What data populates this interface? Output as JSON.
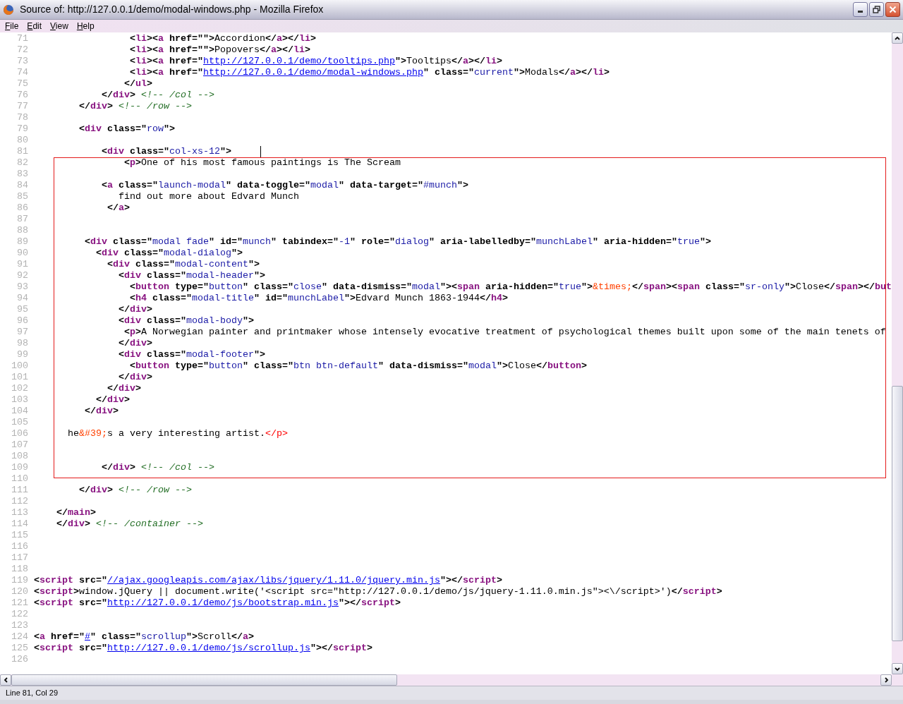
{
  "window": {
    "title": "Source of: http://127.0.0.1/demo/modal-windows.php - Mozilla Firefox"
  },
  "menu": [
    "File",
    "Edit",
    "View",
    "Help"
  ],
  "code_blocks": [
    {
      "highlighted": false,
      "lines": [
        {
          "number": "71",
          "cursor": false,
          "tokens": [
            {
              "kind": "markup",
              "text": "                 <"
            },
            {
              "kind": "tag",
              "text": "li"
            },
            {
              "kind": "markup",
              "text": "><"
            },
            {
              "kind": "tag",
              "text": "a"
            },
            {
              "kind": "markup",
              "text": " href=\"\">"
            },
            {
              "kind": "text",
              "text": "Accordion"
            },
            {
              "kind": "markup",
              "text": "</"
            },
            {
              "kind": "tag",
              "text": "a"
            },
            {
              "kind": "markup",
              "text": "></"
            },
            {
              "kind": "tag",
              "text": "li"
            },
            {
              "kind": "markup",
              "text": ">"
            }
          ]
        },
        {
          "number": "72",
          "cursor": false,
          "tokens": [
            {
              "kind": "markup",
              "text": "                 <"
            },
            {
              "kind": "tag",
              "text": "li"
            },
            {
              "kind": "markup",
              "text": "><"
            },
            {
              "kind": "tag",
              "text": "a"
            },
            {
              "kind": "markup",
              "text": " href=\"\">"
            },
            {
              "kind": "text",
              "text": "Popovers"
            },
            {
              "kind": "markup",
              "text": "</"
            },
            {
              "kind": "tag",
              "text": "a"
            },
            {
              "kind": "markup",
              "text": "></"
            },
            {
              "kind": "tag",
              "text": "li"
            },
            {
              "kind": "markup",
              "text": ">"
            }
          ]
        },
        {
          "number": "73",
          "cursor": false,
          "tokens": [
            {
              "kind": "markup",
              "text": "                 <"
            },
            {
              "kind": "tag",
              "text": "li"
            },
            {
              "kind": "markup",
              "text": "><"
            },
            {
              "kind": "tag",
              "text": "a"
            },
            {
              "kind": "markup",
              "text": " href=\""
            },
            {
              "kind": "link",
              "text": "http://127.0.0.1/demo/tooltips.php"
            },
            {
              "kind": "markup",
              "text": "\">"
            },
            {
              "kind": "text",
              "text": "Tooltips"
            },
            {
              "kind": "markup",
              "text": "</"
            },
            {
              "kind": "tag",
              "text": "a"
            },
            {
              "kind": "markup",
              "text": "></"
            },
            {
              "kind": "tag",
              "text": "li"
            },
            {
              "kind": "markup",
              "text": ">"
            }
          ]
        },
        {
          "number": "74",
          "cursor": false,
          "tokens": [
            {
              "kind": "markup",
              "text": "                 <"
            },
            {
              "kind": "tag",
              "text": "li"
            },
            {
              "kind": "markup",
              "text": "><"
            },
            {
              "kind": "tag",
              "text": "a"
            },
            {
              "kind": "markup",
              "text": " href=\""
            },
            {
              "kind": "link",
              "text": "http://127.0.0.1/demo/modal-windows.php"
            },
            {
              "kind": "markup",
              "text": "\" class=\""
            },
            {
              "kind": "value",
              "text": "current"
            },
            {
              "kind": "markup",
              "text": "\">"
            },
            {
              "kind": "text",
              "text": "Modals"
            },
            {
              "kind": "markup",
              "text": "</"
            },
            {
              "kind": "tag",
              "text": "a"
            },
            {
              "kind": "markup",
              "text": "></"
            },
            {
              "kind": "tag",
              "text": "li"
            },
            {
              "kind": "markup",
              "text": ">"
            }
          ]
        },
        {
          "number": "75",
          "cursor": false,
          "tokens": [
            {
              "kind": "markup",
              "text": "                </"
            },
            {
              "kind": "tag",
              "text": "ul"
            },
            {
              "kind": "markup",
              "text": ">"
            }
          ]
        },
        {
          "number": "76",
          "cursor": false,
          "tokens": [
            {
              "kind": "markup",
              "text": "            </"
            },
            {
              "kind": "tag",
              "text": "div"
            },
            {
              "kind": "markup",
              "text": "> "
            },
            {
              "kind": "comment",
              "text": "<!-- /col -->"
            }
          ]
        },
        {
          "number": "77",
          "cursor": false,
          "tokens": [
            {
              "kind": "markup",
              "text": "        </"
            },
            {
              "kind": "tag",
              "text": "div"
            },
            {
              "kind": "markup",
              "text": "> "
            },
            {
              "kind": "comment",
              "text": "<!-- /row -->"
            }
          ]
        },
        {
          "number": "78",
          "cursor": false
        },
        {
          "number": "79",
          "cursor": false,
          "tokens": [
            {
              "kind": "markup",
              "text": "        <"
            },
            {
              "kind": "tag",
              "text": "div"
            },
            {
              "kind": "markup",
              "text": " class=\""
            },
            {
              "kind": "value",
              "text": "row"
            },
            {
              "kind": "markup",
              "text": "\">"
            }
          ]
        },
        {
          "number": "80",
          "cursor": false
        },
        {
          "number": "81",
          "cursor": true,
          "tokens": [
            {
              "kind": "markup",
              "text": "            <"
            },
            {
              "kind": "tag",
              "text": "div"
            },
            {
              "kind": "markup",
              "text": " class=\""
            },
            {
              "kind": "value",
              "text": "col-xs-12"
            },
            {
              "kind": "markup",
              "text": "\">"
            }
          ]
        }
      ]
    },
    {
      "highlighted": true,
      "lines": [
        {
          "number": "82",
          "cursor": false,
          "tokens": [
            {
              "kind": "markup",
              "text": "                <"
            },
            {
              "kind": "tag",
              "text": "p"
            },
            {
              "kind": "markup",
              "text": ">"
            },
            {
              "kind": "text",
              "text": "One of his most famous paintings is The Scream"
            }
          ]
        },
        {
          "number": "83",
          "cursor": false
        },
        {
          "number": "84",
          "cursor": false,
          "tokens": [
            {
              "kind": "markup",
              "text": "            <"
            },
            {
              "kind": "tag",
              "text": "a"
            },
            {
              "kind": "markup",
              "text": " class=\""
            },
            {
              "kind": "value",
              "text": "launch-modal"
            },
            {
              "kind": "markup",
              "text": "\" data-toggle=\""
            },
            {
              "kind": "value",
              "text": "modal"
            },
            {
              "kind": "markup",
              "text": "\" data-target=\""
            },
            {
              "kind": "value",
              "text": "#munch"
            },
            {
              "kind": "markup",
              "text": "\">"
            }
          ]
        },
        {
          "number": "85",
          "cursor": false,
          "tokens": [
            {
              "kind": "text",
              "text": "               find out more about Edvard Munch"
            }
          ]
        },
        {
          "number": "86",
          "cursor": false,
          "tokens": [
            {
              "kind": "markup",
              "text": "             </"
            },
            {
              "kind": "tag",
              "text": "a"
            },
            {
              "kind": "markup",
              "text": ">"
            }
          ]
        },
        {
          "number": "87",
          "cursor": false
        },
        {
          "number": "88",
          "cursor": false
        },
        {
          "number": "89",
          "cursor": false,
          "tokens": [
            {
              "kind": "markup",
              "text": "         <"
            },
            {
              "kind": "tag",
              "text": "div"
            },
            {
              "kind": "markup",
              "text": " class=\""
            },
            {
              "kind": "value",
              "text": "modal fade"
            },
            {
              "kind": "markup",
              "text": "\" id=\""
            },
            {
              "kind": "value",
              "text": "munch"
            },
            {
              "kind": "markup",
              "text": "\" tabindex=\""
            },
            {
              "kind": "value",
              "text": "-1"
            },
            {
              "kind": "markup",
              "text": "\" role=\""
            },
            {
              "kind": "value",
              "text": "dialog"
            },
            {
              "kind": "markup",
              "text": "\" aria-labelledby=\""
            },
            {
              "kind": "value",
              "text": "munchLabel"
            },
            {
              "kind": "markup",
              "text": "\" aria-hidden=\""
            },
            {
              "kind": "value",
              "text": "true"
            },
            {
              "kind": "markup",
              "text": "\">"
            }
          ]
        },
        {
          "number": "90",
          "cursor": false,
          "tokens": [
            {
              "kind": "markup",
              "text": "           <"
            },
            {
              "kind": "tag",
              "text": "div"
            },
            {
              "kind": "markup",
              "text": " class=\""
            },
            {
              "kind": "value",
              "text": "modal-dialog"
            },
            {
              "kind": "markup",
              "text": "\">"
            }
          ]
        },
        {
          "number": "91",
          "cursor": false,
          "tokens": [
            {
              "kind": "markup",
              "text": "             <"
            },
            {
              "kind": "tag",
              "text": "div"
            },
            {
              "kind": "markup",
              "text": " class=\""
            },
            {
              "kind": "value",
              "text": "modal-content"
            },
            {
              "kind": "markup",
              "text": "\">"
            }
          ]
        },
        {
          "number": "92",
          "cursor": false,
          "tokens": [
            {
              "kind": "markup",
              "text": "               <"
            },
            {
              "kind": "tag",
              "text": "div"
            },
            {
              "kind": "markup",
              "text": " class=\""
            },
            {
              "kind": "value",
              "text": "modal-header"
            },
            {
              "kind": "markup",
              "text": "\">"
            }
          ]
        },
        {
          "number": "93",
          "cursor": false,
          "tokens": [
            {
              "kind": "markup",
              "text": "                 <"
            },
            {
              "kind": "tag",
              "text": "button"
            },
            {
              "kind": "markup",
              "text": " type=\""
            },
            {
              "kind": "value",
              "text": "button"
            },
            {
              "kind": "markup",
              "text": "\" class=\""
            },
            {
              "kind": "value",
              "text": "close"
            },
            {
              "kind": "markup",
              "text": "\" data-dismiss=\""
            },
            {
              "kind": "value",
              "text": "modal"
            },
            {
              "kind": "markup",
              "text": "\"><"
            },
            {
              "kind": "tag",
              "text": "span"
            },
            {
              "kind": "markup",
              "text": " aria-hidden=\""
            },
            {
              "kind": "value",
              "text": "true"
            },
            {
              "kind": "markup",
              "text": "\">"
            },
            {
              "kind": "entity",
              "text": "&times;"
            },
            {
              "kind": "markup",
              "text": "</"
            },
            {
              "kind": "tag",
              "text": "span"
            },
            {
              "kind": "markup",
              "text": "><"
            },
            {
              "kind": "tag",
              "text": "span"
            },
            {
              "kind": "markup",
              "text": " class=\""
            },
            {
              "kind": "value",
              "text": "sr-only"
            },
            {
              "kind": "markup",
              "text": "\">"
            },
            {
              "kind": "text",
              "text": "Close"
            },
            {
              "kind": "markup",
              "text": "</"
            },
            {
              "kind": "tag",
              "text": "span"
            },
            {
              "kind": "markup",
              "text": "></"
            },
            {
              "kind": "tag",
              "text": "but"
            }
          ]
        },
        {
          "number": "94",
          "cursor": false,
          "tokens": [
            {
              "kind": "markup",
              "text": "                 <"
            },
            {
              "kind": "tag",
              "text": "h4"
            },
            {
              "kind": "markup",
              "text": " class=\""
            },
            {
              "kind": "value",
              "text": "modal-title"
            },
            {
              "kind": "markup",
              "text": "\" id=\""
            },
            {
              "kind": "value",
              "text": "munchLabel"
            },
            {
              "kind": "markup",
              "text": "\">"
            },
            {
              "kind": "text",
              "text": "Edvard Munch 1863-1944"
            },
            {
              "kind": "markup",
              "text": "</"
            },
            {
              "kind": "tag",
              "text": "h4"
            },
            {
              "kind": "markup",
              "text": ">"
            }
          ]
        },
        {
          "number": "95",
          "cursor": false,
          "tokens": [
            {
              "kind": "markup",
              "text": "               </"
            },
            {
              "kind": "tag",
              "text": "div"
            },
            {
              "kind": "markup",
              "text": ">"
            }
          ]
        },
        {
          "number": "96",
          "cursor": false,
          "tokens": [
            {
              "kind": "markup",
              "text": "               <"
            },
            {
              "kind": "tag",
              "text": "div"
            },
            {
              "kind": "markup",
              "text": " class=\""
            },
            {
              "kind": "value",
              "text": "modal-body"
            },
            {
              "kind": "markup",
              "text": "\">"
            }
          ]
        },
        {
          "number": "97",
          "cursor": false,
          "tokens": [
            {
              "kind": "markup",
              "text": "                <"
            },
            {
              "kind": "tag",
              "text": "p"
            },
            {
              "kind": "markup",
              "text": ">"
            },
            {
              "kind": "text",
              "text": "A Norwegian painter and printmaker whose intensely evocative treatment of psychological themes built upon some of the main tenets of"
            }
          ]
        },
        {
          "number": "98",
          "cursor": false,
          "tokens": [
            {
              "kind": "markup",
              "text": "               </"
            },
            {
              "kind": "tag",
              "text": "div"
            },
            {
              "kind": "markup",
              "text": ">"
            }
          ]
        },
        {
          "number": "99",
          "cursor": false,
          "tokens": [
            {
              "kind": "markup",
              "text": "               <"
            },
            {
              "kind": "tag",
              "text": "div"
            },
            {
              "kind": "markup",
              "text": " class=\""
            },
            {
              "kind": "value",
              "text": "modal-footer"
            },
            {
              "kind": "markup",
              "text": "\">"
            }
          ]
        },
        {
          "number": "100",
          "cursor": false,
          "tokens": [
            {
              "kind": "markup",
              "text": "                 <"
            },
            {
              "kind": "tag",
              "text": "button"
            },
            {
              "kind": "markup",
              "text": " type=\""
            },
            {
              "kind": "value",
              "text": "button"
            },
            {
              "kind": "markup",
              "text": "\" class=\""
            },
            {
              "kind": "value",
              "text": "btn btn-default"
            },
            {
              "kind": "markup",
              "text": "\" data-dismiss=\""
            },
            {
              "kind": "value",
              "text": "modal"
            },
            {
              "kind": "markup",
              "text": "\">"
            },
            {
              "kind": "text",
              "text": "Close"
            },
            {
              "kind": "markup",
              "text": "</"
            },
            {
              "kind": "tag",
              "text": "button"
            },
            {
              "kind": "markup",
              "text": ">"
            }
          ]
        },
        {
          "number": "101",
          "cursor": false,
          "tokens": [
            {
              "kind": "markup",
              "text": "               </"
            },
            {
              "kind": "tag",
              "text": "div"
            },
            {
              "kind": "markup",
              "text": ">"
            }
          ]
        },
        {
          "number": "102",
          "cursor": false,
          "tokens": [
            {
              "kind": "markup",
              "text": "             </"
            },
            {
              "kind": "tag",
              "text": "div"
            },
            {
              "kind": "markup",
              "text": ">"
            }
          ]
        },
        {
          "number": "103",
          "cursor": false,
          "tokens": [
            {
              "kind": "markup",
              "text": "           </"
            },
            {
              "kind": "tag",
              "text": "div"
            },
            {
              "kind": "markup",
              "text": ">"
            }
          ]
        },
        {
          "number": "104",
          "cursor": false,
          "tokens": [
            {
              "kind": "markup",
              "text": "         </"
            },
            {
              "kind": "tag",
              "text": "div"
            },
            {
              "kind": "markup",
              "text": ">"
            }
          ]
        },
        {
          "number": "105",
          "cursor": false
        },
        {
          "number": "106",
          "cursor": false,
          "tokens": [
            {
              "kind": "text",
              "text": "      he"
            },
            {
              "kind": "entity",
              "text": "&#39;"
            },
            {
              "kind": "text",
              "text": "s a very interesting artist."
            },
            {
              "kind": "error",
              "text": "</p>"
            }
          ]
        },
        {
          "number": "107",
          "cursor": false
        },
        {
          "number": "108",
          "cursor": false
        },
        {
          "number": "109",
          "cursor": false,
          "tokens": [
            {
              "kind": "markup",
              "text": "            </"
            },
            {
              "kind": "tag",
              "text": "div"
            },
            {
              "kind": "markup",
              "text": "> "
            },
            {
              "kind": "comment",
              "text": "<!-- /col -->"
            }
          ]
        }
      ]
    },
    {
      "highlighted": false,
      "lines": [
        {
          "number": "110",
          "cursor": false
        },
        {
          "number": "111",
          "cursor": false,
          "tokens": [
            {
              "kind": "markup",
              "text": "        </"
            },
            {
              "kind": "tag",
              "text": "div"
            },
            {
              "kind": "markup",
              "text": "> "
            },
            {
              "kind": "comment",
              "text": "<!-- /row -->"
            }
          ]
        },
        {
          "number": "112",
          "cursor": false
        },
        {
          "number": "113",
          "cursor": false,
          "tokens": [
            {
              "kind": "markup",
              "text": "    </"
            },
            {
              "kind": "tag",
              "text": "main"
            },
            {
              "kind": "markup",
              "text": ">"
            }
          ]
        },
        {
          "number": "114",
          "cursor": false,
          "tokens": [
            {
              "kind": "markup",
              "text": "    </"
            },
            {
              "kind": "tag",
              "text": "div"
            },
            {
              "kind": "markup",
              "text": "> "
            },
            {
              "kind": "comment",
              "text": "<!-- /container -->"
            }
          ]
        },
        {
          "number": "115",
          "cursor": false
        },
        {
          "number": "116",
          "cursor": false
        },
        {
          "number": "117",
          "cursor": false
        },
        {
          "number": "118",
          "cursor": false
        },
        {
          "number": "119",
          "cursor": false,
          "tokens": [
            {
              "kind": "markup",
              "text": "<"
            },
            {
              "kind": "tag",
              "text": "script"
            },
            {
              "kind": "markup",
              "text": " src=\""
            },
            {
              "kind": "link",
              "text": "//ajax.googleapis.com/ajax/libs/jquery/1.11.0/jquery.min.js"
            },
            {
              "kind": "markup",
              "text": "\"></"
            },
            {
              "kind": "tag",
              "text": "script"
            },
            {
              "kind": "markup",
              "text": ">"
            }
          ]
        },
        {
          "number": "120",
          "cursor": false,
          "tokens": [
            {
              "kind": "markup",
              "text": "<"
            },
            {
              "kind": "tag",
              "text": "script"
            },
            {
              "kind": "markup",
              "text": ">"
            },
            {
              "kind": "text",
              "text": "window.jQuery || document.write('<script src=\"http://127.0.0.1/demo/js/jquery-1.11.0.min.js\"><\\/script>')"
            },
            {
              "kind": "markup",
              "text": "</"
            },
            {
              "kind": "tag",
              "text": "script"
            },
            {
              "kind": "markup",
              "text": ">"
            }
          ]
        },
        {
          "number": "121",
          "cursor": false,
          "tokens": [
            {
              "kind": "markup",
              "text": "<"
            },
            {
              "kind": "tag",
              "text": "script"
            },
            {
              "kind": "markup",
              "text": " src=\""
            },
            {
              "kind": "link",
              "text": "http://127.0.0.1/demo/js/bootstrap.min.js"
            },
            {
              "kind": "markup",
              "text": "\"></"
            },
            {
              "kind": "tag",
              "text": "script"
            },
            {
              "kind": "markup",
              "text": ">"
            }
          ]
        },
        {
          "number": "122",
          "cursor": false
        },
        {
          "number": "123",
          "cursor": false
        },
        {
          "number": "124",
          "cursor": false,
          "tokens": [
            {
              "kind": "markup",
              "text": "<"
            },
            {
              "kind": "tag",
              "text": "a"
            },
            {
              "kind": "markup",
              "text": " href=\""
            },
            {
              "kind": "link",
              "text": "#"
            },
            {
              "kind": "markup",
              "text": "\" class=\""
            },
            {
              "kind": "value",
              "text": "scrollup"
            },
            {
              "kind": "markup",
              "text": "\">"
            },
            {
              "kind": "text",
              "text": "Scroll"
            },
            {
              "kind": "markup",
              "text": "</"
            },
            {
              "kind": "tag",
              "text": "a"
            },
            {
              "kind": "markup",
              "text": ">"
            }
          ]
        },
        {
          "number": "125",
          "cursor": false,
          "tokens": [
            {
              "kind": "markup",
              "text": "<"
            },
            {
              "kind": "tag",
              "text": "script"
            },
            {
              "kind": "markup",
              "text": " src=\""
            },
            {
              "kind": "link",
              "text": "http://127.0.0.1/demo/js/scrollup.js"
            },
            {
              "kind": "markup",
              "text": "\"></"
            },
            {
              "kind": "tag",
              "text": "script"
            },
            {
              "kind": "markup",
              "text": ">"
            }
          ]
        },
        {
          "number": "126",
          "cursor": false
        }
      ]
    }
  ],
  "status_bar": {
    "text": "Line 81, Col 29"
  }
}
